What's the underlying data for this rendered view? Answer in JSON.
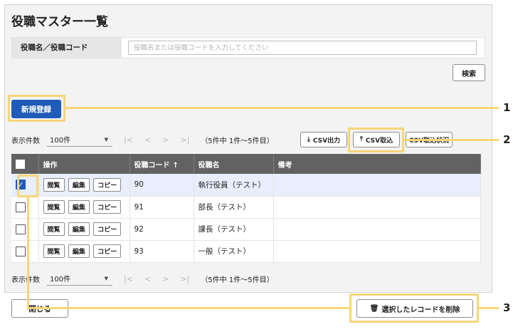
{
  "page": {
    "title": "役職マスター一覧"
  },
  "search": {
    "label": "役職名／役職コード",
    "placeholder": "役職名または役職コードを入力してください",
    "button": "検索"
  },
  "actions": {
    "new_button": "新規登録",
    "csv_export": "CSV出力",
    "csv_import": "CSV取込",
    "csv_history": "CSV取込状況",
    "close_button": "閉じる",
    "delete_button": "選択したレコードを削除"
  },
  "pager": {
    "label": "表示件数",
    "per_page": "100件",
    "nav": [
      "|<",
      "<",
      ">",
      ">|"
    ],
    "summary": "（5件中 1件～5件目）"
  },
  "table": {
    "headers": {
      "op": "操作",
      "code": "役職コード",
      "name": "役職名",
      "note": "備考"
    },
    "row_buttons": {
      "view": "閲覧",
      "edit": "編集",
      "copy": "コピー"
    },
    "rows": [
      {
        "code": "90",
        "name": "執行役員（テスト）",
        "note": "",
        "checked": true
      },
      {
        "code": "91",
        "name": "部長（テスト）",
        "note": "",
        "checked": false
      },
      {
        "code": "92",
        "name": "課長（テスト）",
        "note": "",
        "checked": false
      },
      {
        "code": "93",
        "name": "一般（テスト）",
        "note": "",
        "checked": false
      }
    ]
  },
  "callouts": [
    "1",
    "2",
    "3"
  ],
  "icons": {
    "export": "download-icon",
    "import": "upload-icon",
    "delete": "trash-icon",
    "sort": "arrow-up-icon"
  },
  "colors": {
    "primary": "#1f5bb8",
    "highlight": "#f7d67a",
    "header_bg": "#626262"
  }
}
